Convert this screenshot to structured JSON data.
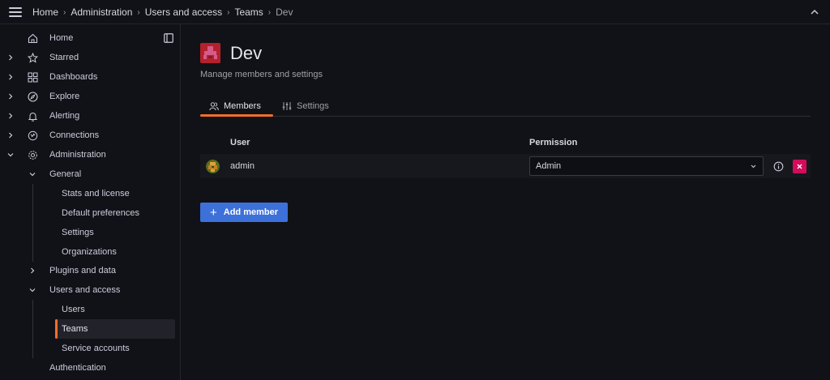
{
  "breadcrumb": [
    "Home",
    "Administration",
    "Users and access",
    "Teams",
    "Dev"
  ],
  "sidebar": {
    "items": [
      {
        "label": "Home",
        "icon": "home-icon"
      },
      {
        "label": "Starred",
        "icon": "star-icon"
      },
      {
        "label": "Dashboards",
        "icon": "dashboards-icon"
      },
      {
        "label": "Explore",
        "icon": "compass-icon"
      },
      {
        "label": "Alerting",
        "icon": "bell-icon"
      },
      {
        "label": "Connections",
        "icon": "connections-icon"
      },
      {
        "label": "Administration",
        "icon": "gear-icon"
      }
    ],
    "sub": {
      "general": "General",
      "stats": "Stats and license",
      "defaults": "Default preferences",
      "settings": "Settings",
      "orgs": "Organizations",
      "plugins": "Plugins and data",
      "users_access": "Users and access",
      "users": "Users",
      "teams": "Teams",
      "service_accounts": "Service accounts",
      "authentication": "Authentication"
    }
  },
  "page": {
    "title": "Dev",
    "subtitle": "Manage members and settings",
    "tabs": [
      {
        "label": "Members",
        "icon": "users-icon",
        "active": true
      },
      {
        "label": "Settings",
        "icon": "sliders-icon",
        "active": false
      }
    ]
  },
  "table": {
    "headers": {
      "user": "User",
      "permission": "Permission"
    },
    "rows": [
      {
        "user": "admin",
        "permission": "Admin"
      }
    ]
  },
  "add_member_label": "Add member",
  "colors": {
    "accent": "#f46e2b",
    "primary": "#3d71d9",
    "danger": "#d10e5c"
  }
}
